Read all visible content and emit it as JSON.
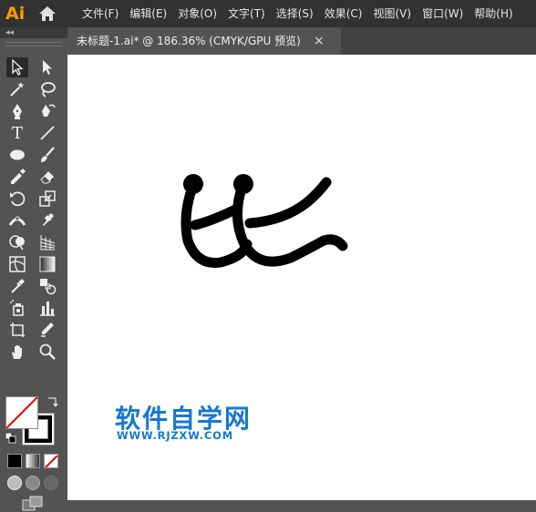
{
  "app": {
    "logo_text": "Ai",
    "menu": [
      "文件(F)",
      "编辑(E)",
      "对象(O)",
      "文字(T)",
      "选择(S)",
      "效果(C)",
      "视图(V)",
      "窗口(W)",
      "帮助(H)"
    ]
  },
  "tools_panel": {
    "collapse_label": "◂◂",
    "type_tool_glyph": "T",
    "tools": [
      "selection-tool",
      "direct-selection-tool",
      "magic-wand-tool",
      "lasso-tool",
      "pen-tool",
      "curvature-tool",
      "type-tool",
      "line-segment-tool",
      "ellipse-tool",
      "paintbrush-tool",
      "shaper-tool",
      "eraser-tool",
      "rotate-tool",
      "scale-tool",
      "width-tool",
      "puppet-warp-tool",
      "shape-builder-tool",
      "perspective-grid-tool",
      "mesh-tool",
      "gradient-tool",
      "eyedropper-tool",
      "blend-tool",
      "symbol-sprayer-tool",
      "column-graph-tool",
      "artboard-tool",
      "slice-tool",
      "hand-tool",
      "zoom-tool"
    ],
    "active_tool": "selection-tool",
    "fill": "none",
    "stroke": "#000000"
  },
  "document": {
    "tab_title": "未标题-1.ai* @ 186.36% (CMYK/GPU 预览)",
    "close_glyph": "×"
  },
  "canvas": {
    "watermark_text": "软件自学网",
    "watermark_url": "WWW.RJZXW.COM",
    "watermark_color": "#1478d2",
    "artwork_stroke_color": "#000000"
  }
}
